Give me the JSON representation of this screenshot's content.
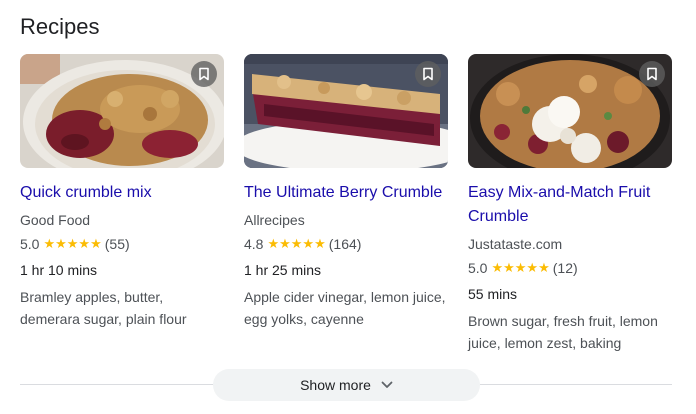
{
  "section": {
    "title": "Recipes"
  },
  "recipes": [
    {
      "title": "Quick crumble mix",
      "source": "Good Food",
      "rating": "5.0",
      "stars": "★★★★★",
      "reviews": "(55)",
      "time": "1 hr 10 mins",
      "ingredients": "Bramley apples, butter, demerara sugar, plain flour"
    },
    {
      "title": "The Ultimate Berry Crumble",
      "source": "Allrecipes",
      "rating": "4.8",
      "stars": "★★★★★",
      "reviews": "(164)",
      "time": "1 hr 25 mins",
      "ingredients": "Apple cider vinegar, lemon juice, egg yolks, cayenne"
    },
    {
      "title": "Easy Mix-and-Match Fruit Crumble",
      "source": "Justataste.com",
      "rating": "5.0",
      "stars": "★★★★★",
      "reviews": "(12)",
      "time": "55 mins",
      "ingredients": "Brown sugar, fresh fruit, lemon juice, lemon zest, baking"
    }
  ],
  "footer": {
    "show_more": "Show more"
  },
  "icons": {
    "save": "bookmark-icon",
    "expand": "chevron-down-icon"
  },
  "colors": {
    "link": "#1a0dab",
    "star": "#fbbc04",
    "button_bg": "#f1f3f4"
  }
}
